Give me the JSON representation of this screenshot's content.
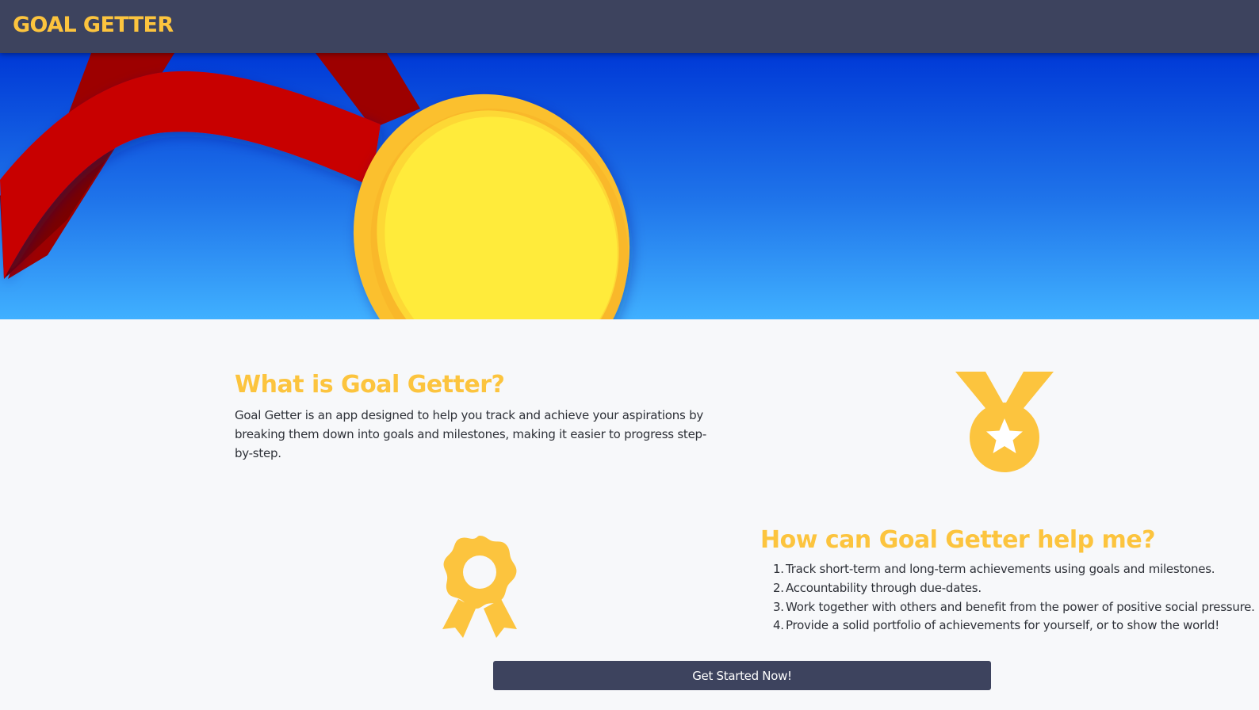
{
  "navbar": {
    "brand": "GOAL GETTER"
  },
  "colors": {
    "navbar_bg": "#3d435e",
    "accent_gold": "#fcc43e",
    "hero_sky_top": "#0039d6",
    "hero_sky_bottom": "#3fb0ff",
    "ribbon_red": "#c80000",
    "medal_yellow": "#ffeb3b"
  },
  "hero": {
    "image": "gold-medal-with-red-ribbon"
  },
  "about": {
    "title": "What is Goal Getter?",
    "description": "Goal Getter is an app designed to help you track and achieve your aspirations by breaking them down into goals and milestones, making it easier to progress step-by-step.",
    "icon": "medal-star-icon"
  },
  "help": {
    "title": "How can Goal Getter help me?",
    "icon": "award-ribbon-icon",
    "items": [
      {
        "num": "1.",
        "text": "Track short-term and long-term achievements using goals and milestones."
      },
      {
        "num": "2.",
        "text": "Accountability through due-dates."
      },
      {
        "num": "3.",
        "text": "Work together with others and benefit from the power of positive social pressure."
      },
      {
        "num": "4.",
        "text": "Provide a solid portfolio of achievements for yourself, or to show the world!"
      }
    ]
  },
  "cta": {
    "label": "Get Started Now!"
  }
}
